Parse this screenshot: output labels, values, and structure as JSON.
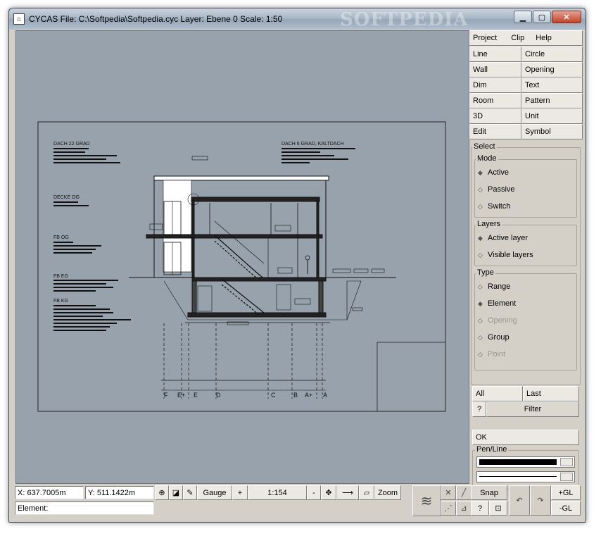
{
  "window": {
    "title": "CYCAS  File: C:\\Softpedia\\Softpedia.cyc  Layer: Ebene 0  Scale: 1:50",
    "watermark": "SOFTPEDIA"
  },
  "menu": {
    "project": "Project",
    "clip": "Clip",
    "help": "Help"
  },
  "tools": {
    "line": "Line",
    "circle": "Circle",
    "wall": "Wall",
    "opening": "Opening",
    "dim": "Dim",
    "text": "Text",
    "room": "Room",
    "pattern": "Pattern",
    "threed": "3D",
    "unit": "Unit",
    "edit": "Edit",
    "symbol": "Symbol"
  },
  "select": {
    "title": "Select",
    "mode": {
      "title": "Mode",
      "active": "Active",
      "passive": "Passive",
      "switch": "Switch"
    },
    "layers": {
      "title": "Layers",
      "active_layer": "Active layer",
      "visible_layers": "Visible layers"
    },
    "type": {
      "title": "Type",
      "range": "Range",
      "element": "Element",
      "opening": "Opening",
      "group": "Group",
      "point": "Point"
    },
    "all": "All",
    "last": "Last",
    "help": "?",
    "filter": "Filter",
    "ok": "OK",
    "penline": "Pen/Line"
  },
  "status": {
    "x": "X: 637.7005m",
    "y": "Y: 511.1422m",
    "element": "Element:",
    "gauge": "Gauge",
    "plus": "+",
    "scale": "1:154",
    "minus": "-",
    "zoom": "Zoom",
    "snap": "Snap",
    "help": "?",
    "plus_gl": "+GL",
    "minus_gl": "-GL"
  },
  "drawing": {
    "labels_left": [
      "DACH 22 GRAD",
      "DECKE OG",
      "FB OG",
      "FB EG",
      "FB KG"
    ],
    "label_right": "DACH 6 GRAD, KALTDACH",
    "axis_labels": [
      "F",
      "E+",
      "E",
      "D",
      "C",
      "B",
      "A+",
      "A"
    ]
  }
}
